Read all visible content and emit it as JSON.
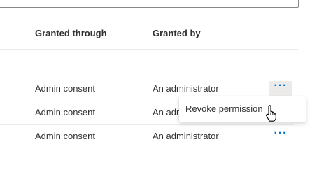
{
  "table": {
    "columns": {
      "granted_through": "Granted through",
      "granted_by": "Granted by"
    },
    "rows": [
      {
        "granted_through": "Admin consent",
        "granted_by": "An administrator",
        "actions_icon": "more-horizontal-icon",
        "actions_label": "···"
      },
      {
        "granted_through": "Admin consent",
        "granted_by": "An administrator",
        "actions_icon": "more-horizontal-icon",
        "actions_label": "···"
      },
      {
        "granted_through": "Admin consent",
        "granted_by": "An administrator",
        "actions_icon": "more-horizontal-icon",
        "actions_label": "···"
      }
    ]
  },
  "context_menu": {
    "items": [
      {
        "label": "Revoke permission"
      }
    ]
  },
  "colors": {
    "accent": "#0078d4",
    "text": "#323130",
    "divider": "#edebe9",
    "active_button_bg": "#edebe9"
  }
}
